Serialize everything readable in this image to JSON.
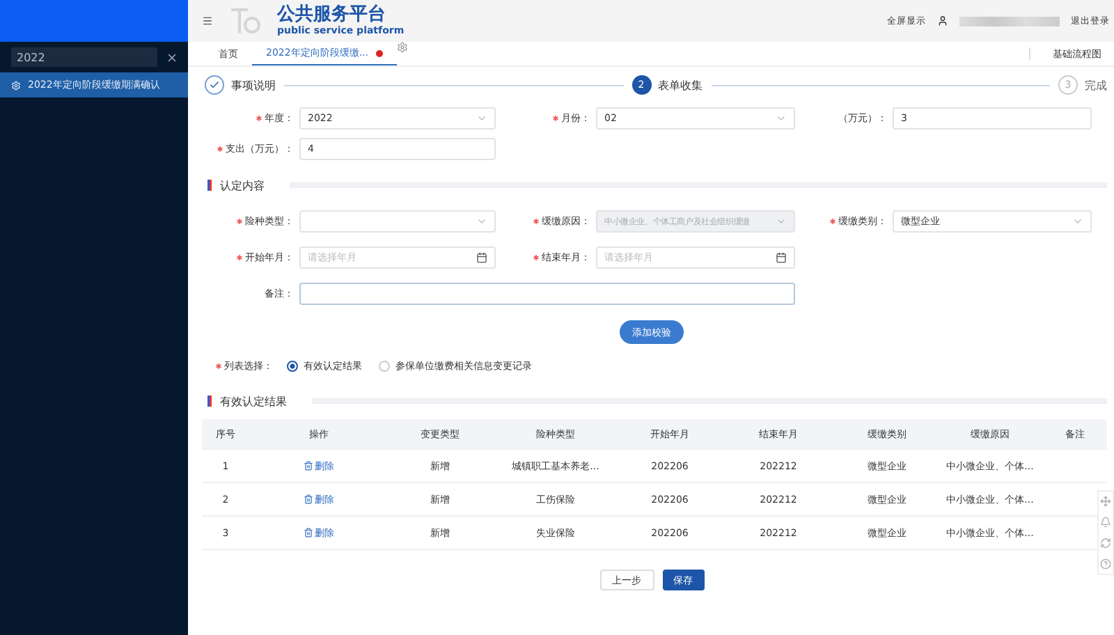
{
  "sidebar": {
    "search": {
      "value": "2022"
    },
    "items": [
      {
        "label": "2022年定向阶段缓缴期满确认",
        "selected": true
      }
    ]
  },
  "header": {
    "title": "公共服务平台",
    "subtitle": "public service platform",
    "links": [
      "全屏显示",
      "退出登录"
    ]
  },
  "tabs": [
    {
      "label": "首页",
      "selected": false,
      "closable": false
    },
    {
      "label": "2022年定向阶段缓缴...",
      "selected": true,
      "closable": true
    }
  ],
  "tab_bar_right": "基础流程图",
  "steps": [
    {
      "label": "事项说明",
      "completed": true,
      "selected": false
    },
    {
      "number": "2",
      "label": "表单收集",
      "completed": false,
      "selected": true
    },
    {
      "number": "3",
      "label": "完成",
      "completed": false,
      "selected": false
    }
  ],
  "basic_rows": [
    [
      {
        "label": "年度：",
        "kind": "select",
        "value": "2022",
        "required": true,
        "disabled": false
      },
      {
        "label": "月份：",
        "kind": "select",
        "value": "02",
        "required": true,
        "disabled": false
      },
      {
        "label": "（万元）：",
        "kind": "input",
        "value": "3",
        "required": false,
        "disabled": false
      }
    ],
    [
      {
        "label": "支出（万元）：",
        "kind": "input",
        "value": "4",
        "required": true,
        "disabled": false
      }
    ]
  ],
  "section_1": "认定内容",
  "recognition_rows": [
    [
      {
        "label": "险种类型：",
        "kind": "select",
        "required": true,
        "disabled": false
      },
      {
        "label": "缓缴原因：",
        "kind": "select",
        "value": "中小微企业、个体工商户及社会组织缓缴",
        "required": true,
        "disabled": true
      },
      {
        "label": "缓缴类别：",
        "kind": "select",
        "value": "微型企业",
        "required": true,
        "disabled": false
      }
    ],
    [
      {
        "label": "开始年月：",
        "kind": "date",
        "placeholder": "请选择年月",
        "required": true,
        "disabled": false
      },
      {
        "label": "结束年月：",
        "kind": "date",
        "placeholder": "请选择年月",
        "required": true,
        "disabled": false
      }
    ],
    [
      {
        "label": "备注：",
        "kind": "textarea",
        "required": false,
        "disabled": false
      }
    ]
  ],
  "add_button": "添加校验",
  "list_choice": {
    "label": "列表选择：",
    "options": [
      {
        "label": "有效认定结果",
        "selected": true
      },
      {
        "label": "参保单位缴费相关信息变更记录",
        "selected": false
      }
    ]
  },
  "section_2": "有效认定结果",
  "table": {
    "columns": [
      "序号",
      "操作",
      "变更类型",
      "险种类型",
      "开始年月",
      "结束年月",
      "缓缴类别",
      "缓缴原因",
      "备注"
    ],
    "rows": [
      {
        "cells": [
          "1",
          "删除",
          "新增",
          "城镇职工基本养老...",
          "202206",
          "202212",
          "微型企业",
          "中小微企业、个体...",
          ""
        ]
      },
      {
        "cells": [
          "2",
          "删除",
          "新增",
          "工伤保险",
          "202206",
          "202212",
          "微型企业",
          "中小微企业、个体...",
          ""
        ]
      },
      {
        "cells": [
          "3",
          "删除",
          "新增",
          "失业保险",
          "202206",
          "202212",
          "微型企业",
          "中小微企业、个体...",
          ""
        ]
      }
    ]
  },
  "footer_buttons": [
    {
      "label": "上一步",
      "kind": "secondary"
    },
    {
      "label": "保存",
      "kind": "primary"
    }
  ]
}
